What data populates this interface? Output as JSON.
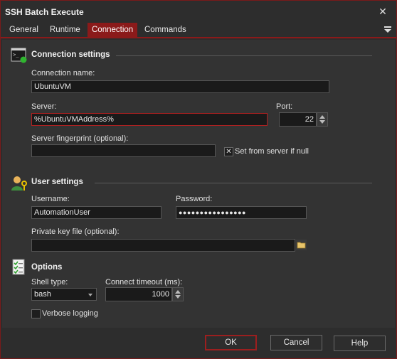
{
  "window": {
    "title": "SSH Batch Execute",
    "close_glyph": "✕"
  },
  "tabs": [
    {
      "label": "General"
    },
    {
      "label": "Runtime"
    },
    {
      "label": "Connection"
    },
    {
      "label": "Commands"
    }
  ],
  "active_tab": "Connection",
  "connection": {
    "header": "Connection settings",
    "icon": "terminal-icon",
    "name_label": "Connection name:",
    "name_value": "UbuntuVM",
    "server_label": "Server:",
    "server_value": "%UbuntuVMAddress%",
    "port_label": "Port:",
    "port_value": "22",
    "fingerprint_label": "Server fingerprint (optional):",
    "fingerprint_value": "",
    "set_from_server_label": "Set from server if null",
    "set_from_server_checked": true
  },
  "user": {
    "header": "User settings",
    "icon": "user-key-icon",
    "username_label": "Username:",
    "username_value": "AutomationUser",
    "password_label": "Password:",
    "password_value": "●●●●●●●●●●●●●●●●",
    "private_key_label": "Private key file (optional):",
    "private_key_value": ""
  },
  "options": {
    "header": "Options",
    "icon": "checklist-icon",
    "shell_type_label": "Shell type:",
    "shell_type_value": "bash",
    "timeout_label": "Connect timeout (ms):",
    "timeout_value": "1000",
    "verbose_label": "Verbose logging",
    "verbose_checked": false
  },
  "buttons": {
    "ok": "OK",
    "cancel": "Cancel",
    "help": "Help"
  },
  "colors": {
    "accent": "#8b1a1a",
    "background": "#2d2d2d",
    "input_bg": "#1a1a1a"
  }
}
